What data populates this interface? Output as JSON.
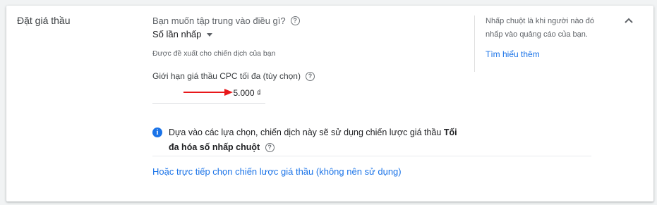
{
  "section": {
    "title": "Đặt giá thầu"
  },
  "focus": {
    "question": "Bạn muốn tập trung vào điều gì?",
    "selected": "Số lần nhấp",
    "hint": "Được đề xuất cho chiến dịch của bạn"
  },
  "cpc": {
    "label": "Giới hạn giá thầu CPC tối đa (tùy chọn)",
    "value": "5.000 ₫"
  },
  "info": {
    "text_prefix": "Dựa vào các lựa chọn, chiến dịch này sẽ sử dụng chiến lược giá thầu ",
    "strategy": "Tối đa hóa số nhấp chuột"
  },
  "manual_link": "Hoặc trực tiếp chọn chiến lược giá thầu (không nên sử dụng)",
  "sidebar": {
    "description": "Nhấp chuột là khi người nào đó nhấp vào quảng cáo của bạn.",
    "learn_more": "Tìm hiểu thêm"
  },
  "icons": {
    "help": "help-circle-icon",
    "info": "info-icon",
    "dropdown": "caret-down-icon",
    "collapse": "chevron-up-icon",
    "annotation": "red-arrow"
  },
  "colors": {
    "accent": "#1a73e8",
    "annotation": "#e8171a"
  }
}
